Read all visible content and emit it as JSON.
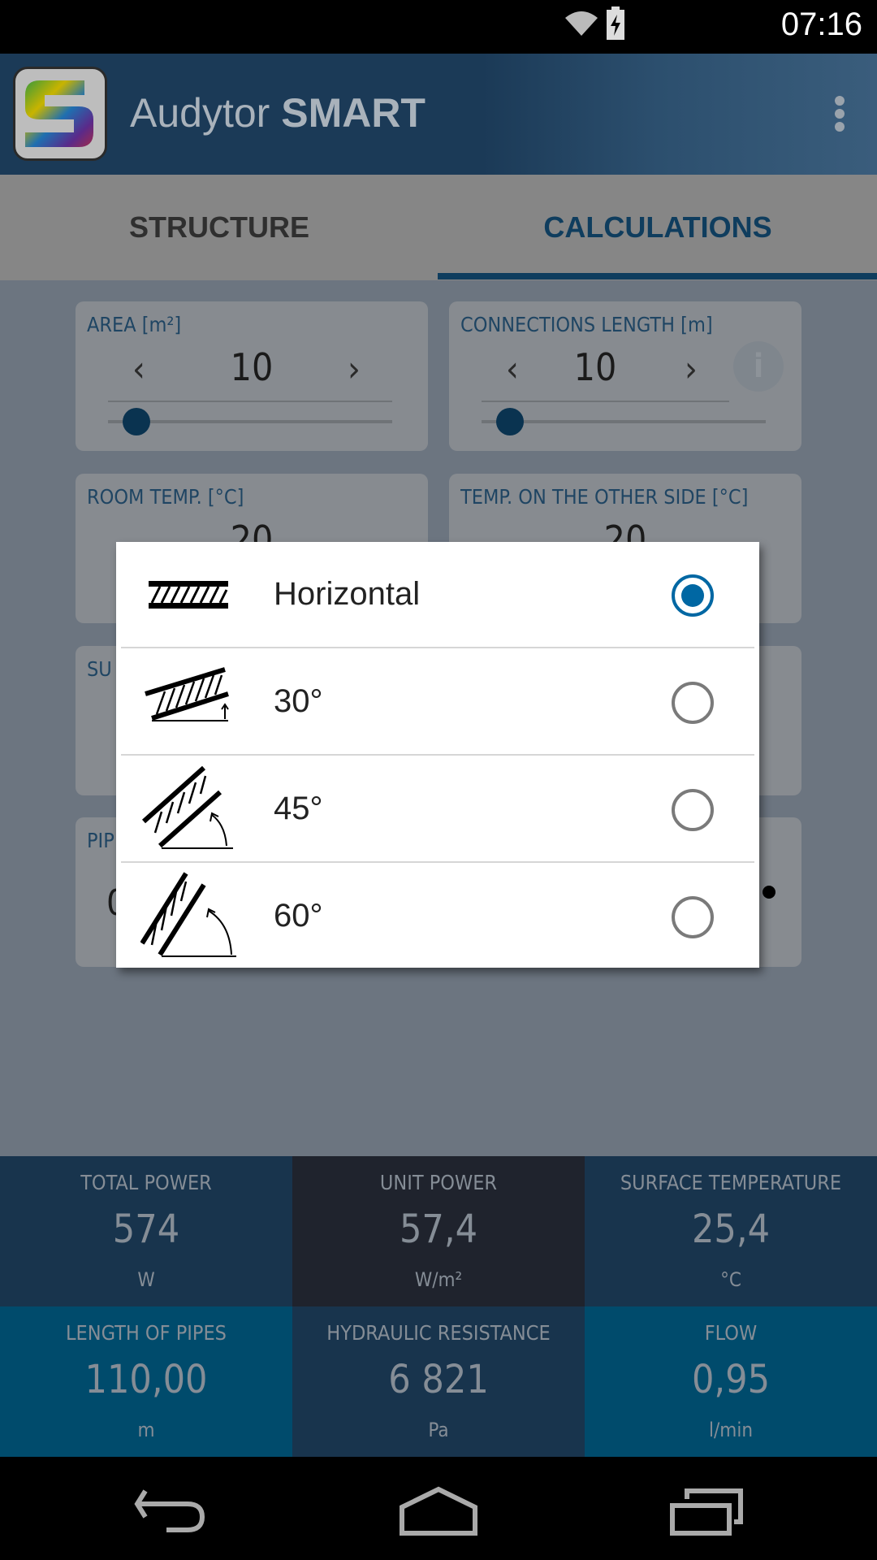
{
  "status_bar": {
    "time": "07:16",
    "icons": [
      "wifi-icon",
      "battery-charging-icon"
    ]
  },
  "app_bar": {
    "title_light": "Audytor ",
    "title_bold": "SMART",
    "logo": "Audytor S logo",
    "menu_icon": "overflow-menu-icon"
  },
  "tabs": [
    {
      "label": "STRUCTURE",
      "active": false
    },
    {
      "label": "CALCULATIONS",
      "active": true
    }
  ],
  "cards": [
    {
      "label": "AREA [m²]",
      "value": "10",
      "slider_fraction": 0.06
    },
    {
      "label": "CONNECTIONS LENGTH [m]",
      "value": "10",
      "slider_fraction": 0.06,
      "info_icon": "info-icon"
    },
    {
      "label": "ROOM TEMP. [°C]",
      "value": "20"
    },
    {
      "label": "TEMP. ON THE OTHER SIDE [°C]",
      "value": "20"
    },
    {
      "label": "SU"
    },
    {
      "label": "PIP",
      "value": "0"
    }
  ],
  "dialog": {
    "options": [
      {
        "label": "Horizontal",
        "selected": true,
        "icon": "horizontal-layer-icon"
      },
      {
        "label": "30°",
        "selected": false,
        "icon": "incline-30-icon"
      },
      {
        "label": "45°",
        "selected": false,
        "icon": "incline-45-icon"
      },
      {
        "label": "60°",
        "selected": false,
        "icon": "incline-60-icon"
      }
    ],
    "accent": "#0067a3"
  },
  "stats": [
    {
      "label": "TOTAL POWER",
      "value": "574",
      "unit": "W",
      "bg": "#18344d"
    },
    {
      "label": "UNIT POWER",
      "value": "57,4",
      "unit": "W/m²",
      "bg": "#1f232d"
    },
    {
      "label": "SURFACE TEMPERATURE",
      "value": "25,4",
      "unit": "°C",
      "bg": "#18344d"
    },
    {
      "label": "LENGTH OF PIPES",
      "value": "110,00",
      "unit": "m",
      "bg": "#004b6c"
    },
    {
      "label": "HYDRAULIC RESISTANCE",
      "value": "6 821",
      "unit": "Pa",
      "bg": "#18344d"
    },
    {
      "label": "FLOW",
      "value": "0,95",
      "unit": "l/min",
      "bg": "#004b6c"
    }
  ],
  "nav": [
    "back-icon",
    "home-icon",
    "recents-icon"
  ]
}
